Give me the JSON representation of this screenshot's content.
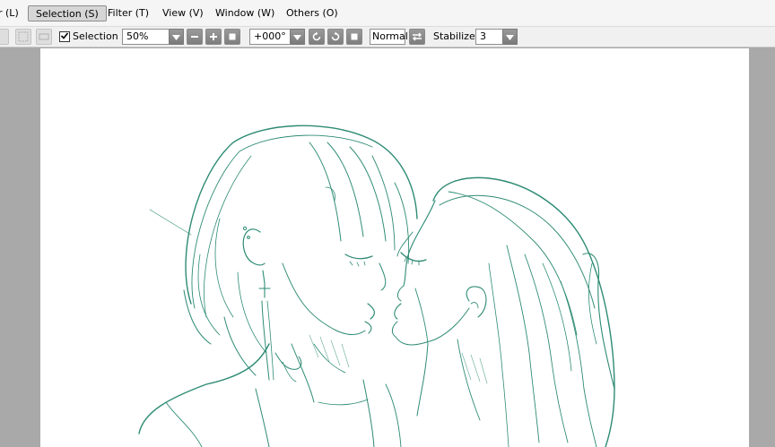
{
  "menubar": {
    "items": [
      {
        "label": "r (L)"
      },
      {
        "label": "Selection (S)"
      },
      {
        "label": "Filter (T)"
      },
      {
        "label": "View (V)"
      },
      {
        "label": "Window (W)"
      },
      {
        "label": "Others (O)"
      }
    ]
  },
  "toolbar": {
    "selection_checkbox_label": "Selection",
    "selection_checked": true,
    "zoom_value": "50%",
    "rotation_value": "+000°",
    "blend_mode": "Normal",
    "stabilizer_label": "Stabilizer",
    "stabilizer_value": "3"
  },
  "icons": {
    "zoom_dropdown": "chevron-down-icon",
    "zoom_out": "minus-icon",
    "zoom_in": "plus-icon",
    "zoom_fit": "square-icon",
    "rotate_ccw": "rotate-ccw-icon",
    "rotate_cw": "rotate-cw-icon",
    "rotate_reset": "square-icon",
    "flip": "flip-horizontal-icon"
  },
  "colors": {
    "line_art": "#2e8b74",
    "canvas_bg": "#ffffff",
    "workspace_bg": "#a9a9a9"
  }
}
